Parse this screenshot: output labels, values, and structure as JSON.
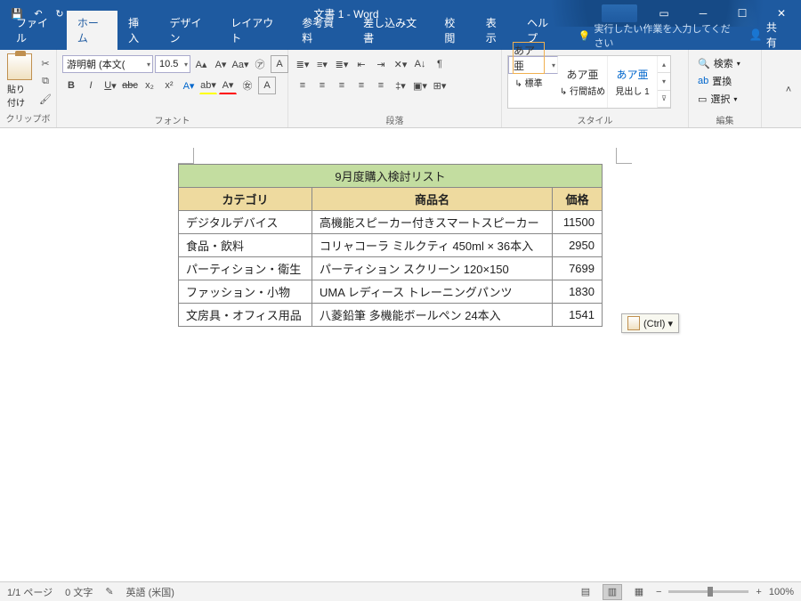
{
  "title": "文書 1  -  Word",
  "qat": [
    "save",
    "undo",
    "redo",
    "customize"
  ],
  "tabs": [
    "ファイル",
    "ホーム",
    "挿入",
    "デザイン",
    "レイアウト",
    "参考資料",
    "差し込み文書",
    "校閲",
    "表示",
    "ヘルプ"
  ],
  "tellme": "実行したい作業を入力してください",
  "share": "共有",
  "ribbon": {
    "clipboard": {
      "label": "クリップボード",
      "paste": "貼り付け"
    },
    "font": {
      "label": "フォント",
      "name": "游明朝 (本文(",
      "size": "10.5"
    },
    "para": {
      "label": "段落"
    },
    "styles": {
      "label": "スタイル",
      "items": [
        {
          "prev": "あア亜",
          "name": "↳ 標準"
        },
        {
          "prev": "あア亜",
          "name": "↳ 行間詰め"
        },
        {
          "prev": "あア亜",
          "name": "見出し 1"
        }
      ]
    },
    "edit": {
      "label": "編集",
      "find": "検索",
      "replace": "置換",
      "select": "選択"
    }
  },
  "table": {
    "title": "9月度購入検討リスト",
    "headers": [
      "カテゴリ",
      "商品名",
      "価格"
    ],
    "rows": [
      [
        "デジタルデバイス",
        "高機能スピーカー付きスマートスピーカー",
        "11500"
      ],
      [
        "食品・飲料",
        "コリャコーラ ミルクティ 450ml × 36本入",
        "2950"
      ],
      [
        "パーティション・衛生",
        "パーティション スクリーン 120×150",
        "7699"
      ],
      [
        "ファッション・小物",
        "UMA レディース トレーニングパンツ",
        "1830"
      ],
      [
        "文房具・オフィス用品",
        "八菱鉛筆 多機能ボールペン 24本入",
        "1541"
      ]
    ]
  },
  "paste_tag": "(Ctrl) ▾",
  "status": {
    "page": "1/1 ページ",
    "words": "0 文字",
    "lang": "英語 (米国)",
    "zoom": "100%"
  }
}
